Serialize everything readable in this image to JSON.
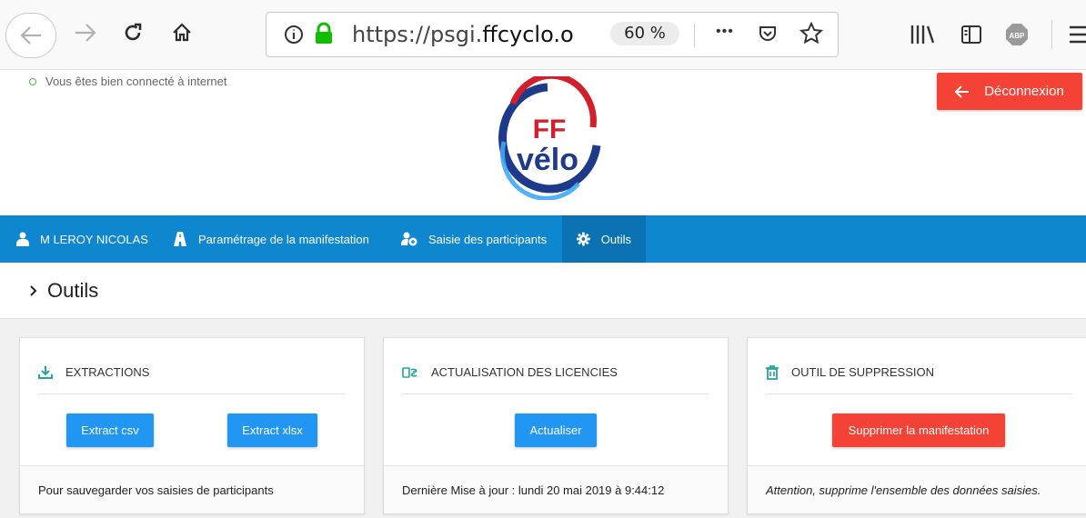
{
  "browser": {
    "url_prefix": "https://psgi.",
    "url_domain": "ffcyclo.org",
    "zoom": "60 %",
    "menu_dots": "•••"
  },
  "status": {
    "text": "Vous êtes bien connecté à internet"
  },
  "header": {
    "logout_label": "Déconnexion",
    "logo_top": "FF",
    "logo_bottom": "vélo"
  },
  "nav": {
    "items": [
      {
        "label": "M LEROY NICOLAS",
        "icon": "user-icon"
      },
      {
        "label": "Paramétrage de la manifestation",
        "icon": "road-icon"
      },
      {
        "label": "Saisie des participants",
        "icon": "participants-icon"
      },
      {
        "label": "Outils",
        "icon": "gear-icon",
        "active": true
      }
    ]
  },
  "page": {
    "title": "Outils"
  },
  "cards": [
    {
      "title": "EXTRACTIONS",
      "icon": "download-icon",
      "buttons": [
        "Extract csv",
        "Extract xlsx"
      ],
      "footer": "Pour sauvegarder vos saisies de participants"
    },
    {
      "title": "ACTUALISATION DES LICENCIES",
      "icon": "refresh-icon",
      "buttons": [
        "Actualiser"
      ],
      "footer": "Dernière Mise à jour : lundi 20 mai 2019 à 9:44:12"
    },
    {
      "title": "OUTIL DE SUPPRESSION",
      "icon": "trash-icon",
      "buttons": [
        "Supprimer la manifestation"
      ],
      "footer": "Attention, supprime l'ensemble des données saisies."
    }
  ],
  "colors": {
    "nav": "#0e87d0",
    "nav_active": "#0a72b1",
    "primary_button": "#2196f3",
    "danger": "#f44336",
    "connected": "#4caf50"
  }
}
